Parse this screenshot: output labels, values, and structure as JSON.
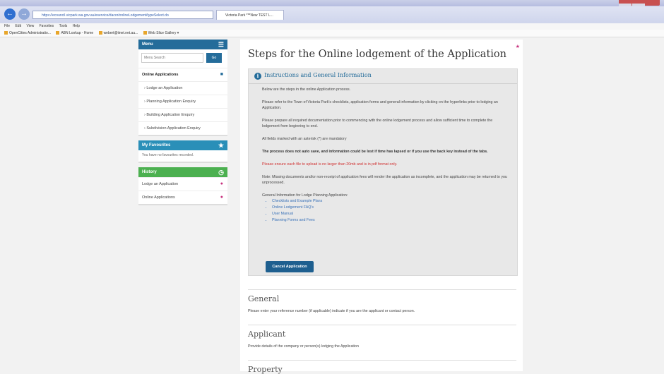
{
  "browser": {
    "url": "https://ecouncil.vicpark.wa.gov.au/eservice/dacor/onlineLodgement/typeSelect.do",
    "tab_title": "Victoria Park ***New TEST L...",
    "menu": [
      "File",
      "Edit",
      "View",
      "Favorites",
      "Tools",
      "Help"
    ],
    "favorites": [
      "OpenCities Administratio...",
      "ABN Lookup - Home",
      "webert@iinet.net.au...",
      "Web Slice Gallery ▾"
    ]
  },
  "sidebar": {
    "menu_header": "Menu",
    "search_placeholder": "Menu Search",
    "go_label": "Go",
    "section_label": "Online Applications",
    "items": [
      {
        "label": "Lodge an Application"
      },
      {
        "label": "Planning Application Enquiry"
      },
      {
        "label": "Building Application Enquiry"
      },
      {
        "label": "Subdivision Application Enquiry"
      }
    ],
    "favourites_header": "My Favourites",
    "favourites_empty": "You have no favourites recorded.",
    "history_header": "History",
    "history_items": [
      {
        "label": "Lodge an Application"
      },
      {
        "label": "Online Applications"
      }
    ]
  },
  "main": {
    "title": "Steps for the Online lodgement of the Application",
    "info_title": "Instructions and General Information",
    "paragraphs": {
      "p1": "Below are the steps in the online Application process.",
      "p2": "Please refer to the Town of Victoria Park's checklists, application forms and general information by clicking on the hyperlinks prior to lodging an Application.",
      "p3": "Please prepare all required documentation prior to commencing with the online lodgement process and allow sufficient time to complete the lodgement from beginning to end.",
      "p4": "All fields marked with an asterisk (*) are mandatory",
      "p5": "The process does not auto save, and information could be lost if time has lapsed or if you use the back key instead of the tabs.",
      "p6": "Please ensure each file to upload is no larger than 20mb and is in pdf format only.",
      "p7": "Note: Missing documents and/or non-receipt of application fees will render the application as incomplete, and the application may be returned to you unprocessed.",
      "p8": "General Information for Lodge Planning Application:"
    },
    "links": [
      "Checklists and Example Plans",
      "Online Lodgement FAQ's",
      "User Manual",
      "Planning Forms and Fees"
    ],
    "cancel_label": "Cancel Application",
    "sections": [
      {
        "title": "General",
        "desc": "Please enter your reference number (if applicable) indicate if you are the applicant or contact person."
      },
      {
        "title": "Applicant",
        "desc": "Provide details of the company or person(s) lodging the Application"
      },
      {
        "title": "Property",
        "desc": ""
      }
    ]
  },
  "colors": {
    "primary": "#246c9a",
    "favourites": "#2a8fb8",
    "history": "#4cb050",
    "alert": "#d03030"
  }
}
